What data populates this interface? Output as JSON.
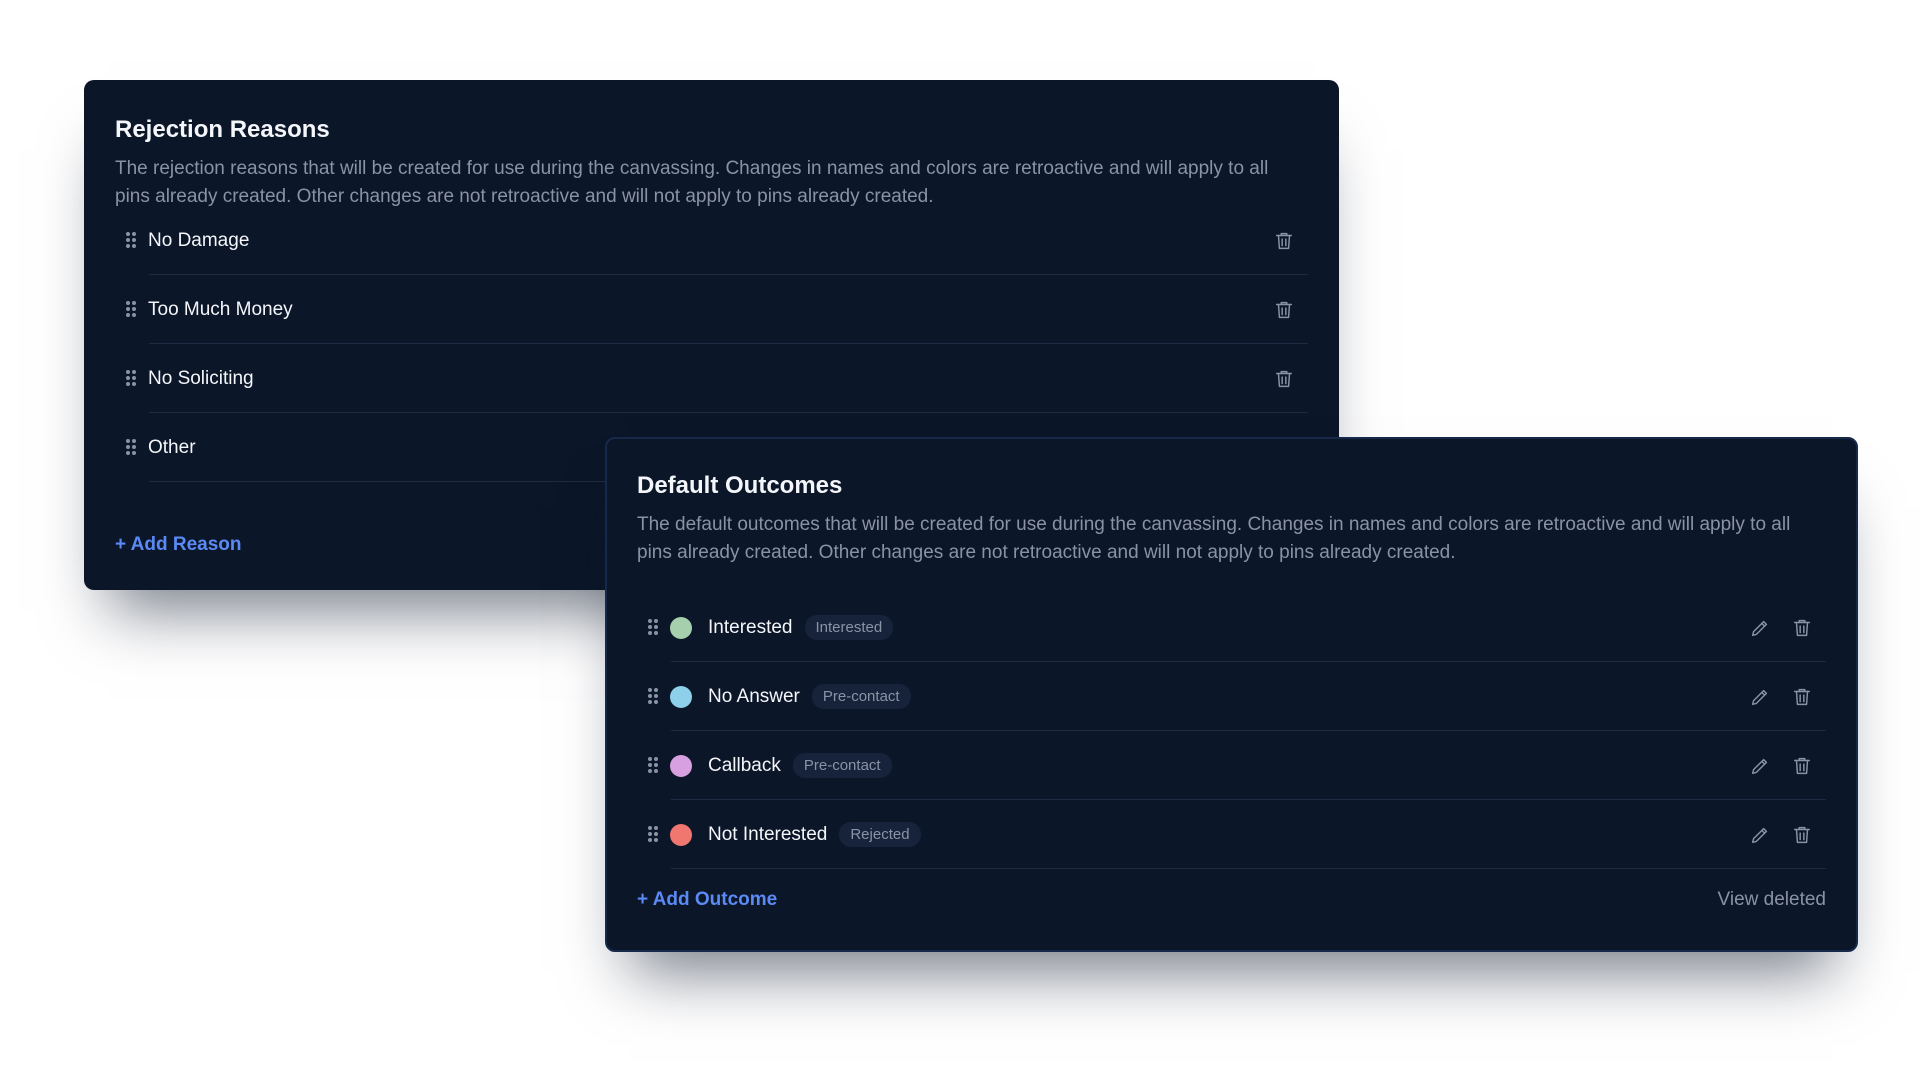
{
  "rejection_reasons": {
    "title": "Rejection Reasons",
    "description": "The rejection reasons that will be created for use during the canvassing. Changes in names and colors are retroactive and will apply to all pins already created. Other changes are not retroactive and will not apply to pins already created.",
    "items": [
      {
        "label": "No Damage"
      },
      {
        "label": "Too Much Money"
      },
      {
        "label": "No Soliciting"
      },
      {
        "label": "Other"
      }
    ],
    "add_label": "+ Add Reason"
  },
  "default_outcomes": {
    "title": "Default Outcomes",
    "description": "The default outcomes that will be created for use during the canvassing. Changes in names and colors are retroactive and will apply to all pins already created. Other changes are not retroactive and will not apply to pins already created.",
    "items": [
      {
        "label": "Interested",
        "badge": "Interested",
        "color": "#a6cfae"
      },
      {
        "label": "No Answer",
        "badge": "Pre-contact",
        "color": "#8ecfea"
      },
      {
        "label": "Callback",
        "badge": "Pre-contact",
        "color": "#d7a0e0"
      },
      {
        "label": "Not Interested",
        "badge": "Rejected",
        "color": "#f07670"
      }
    ],
    "add_label": "+ Add Outcome",
    "view_deleted_label": "View deleted"
  },
  "icons": {
    "drag": "drag-handle-icon",
    "delete": "trash-icon",
    "edit": "pencil-icon"
  },
  "colors": {
    "card_background": "#0b1628",
    "accent": "#5b8af5",
    "muted_text": "#8a93a6"
  }
}
